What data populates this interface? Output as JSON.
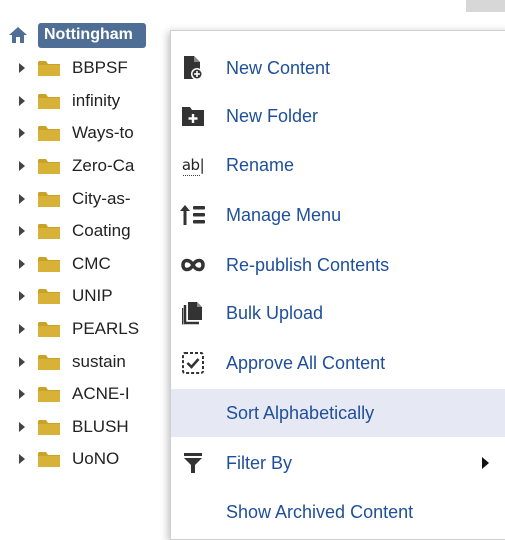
{
  "root": {
    "label": "Nottingham"
  },
  "tree_items": [
    {
      "label": "BBPSF"
    },
    {
      "label": "infinity"
    },
    {
      "label": "Ways-to"
    },
    {
      "label": "Zero-Ca"
    },
    {
      "label": "City-as-"
    },
    {
      "label": "Coating"
    },
    {
      "label": "CMC"
    },
    {
      "label": "UNIP"
    },
    {
      "label": "PEARLS"
    },
    {
      "label": "sustain"
    },
    {
      "label": "ACNE-I"
    },
    {
      "label": "BLUSH"
    },
    {
      "label": "UoNO"
    }
  ],
  "context_menu": {
    "items": [
      {
        "label": "New Content",
        "icon": "new-content-icon"
      },
      {
        "label": "New Folder",
        "icon": "new-folder-icon"
      },
      {
        "label": "Rename",
        "icon": "rename-icon",
        "glyph": "ab|"
      },
      {
        "label": "Manage Menu",
        "icon": "manage-menu-icon"
      },
      {
        "label": "Re-publish Contents",
        "icon": "republish-icon"
      },
      {
        "label": "Bulk Upload",
        "icon": "bulk-upload-icon"
      },
      {
        "label": "Approve All Content",
        "icon": "approve-icon"
      },
      {
        "label": "Sort Alphabetically",
        "icon": "",
        "highlighted": true
      },
      {
        "label": "Filter By",
        "icon": "filter-icon",
        "has_submenu": true
      },
      {
        "label": "Show Archived Content",
        "icon": ""
      }
    ]
  },
  "colors": {
    "root_label_bg": "#4e6e95",
    "menu_text": "#1f4f99",
    "highlight_bg": "#e6e8f4",
    "folder": "#c9a227"
  }
}
